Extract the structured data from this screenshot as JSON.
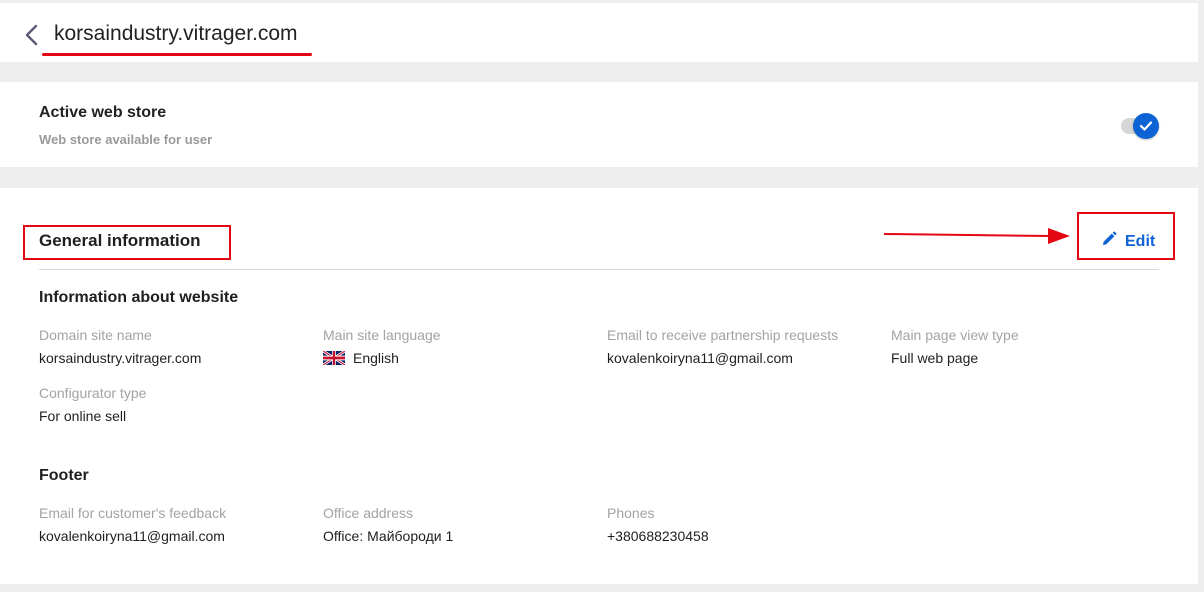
{
  "header": {
    "domain_title": "korsaindustry.vitrager.com"
  },
  "active_store": {
    "title": "Active web store",
    "subtitle": "Web store available for user",
    "enabled": true
  },
  "general": {
    "title": "General information",
    "edit_label": "Edit",
    "website_section": {
      "title": "Information about website",
      "fields": [
        {
          "label": "Domain site name",
          "value": "korsaindustry.vitrager.com"
        },
        {
          "label": "Main site language",
          "value": "English",
          "icon": "uk-flag-icon"
        },
        {
          "label": "Email to receive partnership requests",
          "value": "kovalenkoiryna11@gmail.com"
        },
        {
          "label": "Main page view type",
          "value": "Full web page"
        },
        {
          "label": "Configurator type",
          "value": "For online sell"
        }
      ]
    },
    "footer_section": {
      "title": "Footer",
      "fields": [
        {
          "label": "Email for customer's feedback",
          "value": "kovalenkoiryna11@gmail.com"
        },
        {
          "label": "Office address",
          "value": "Office: Майбороди 1"
        },
        {
          "label": "Phones",
          "value": "+380688230458"
        }
      ]
    }
  },
  "colors": {
    "accent": "#0e63d4",
    "annotation": "#e30613",
    "page_bg": "#eeeeee",
    "label_gray": "#a3a3a3"
  }
}
